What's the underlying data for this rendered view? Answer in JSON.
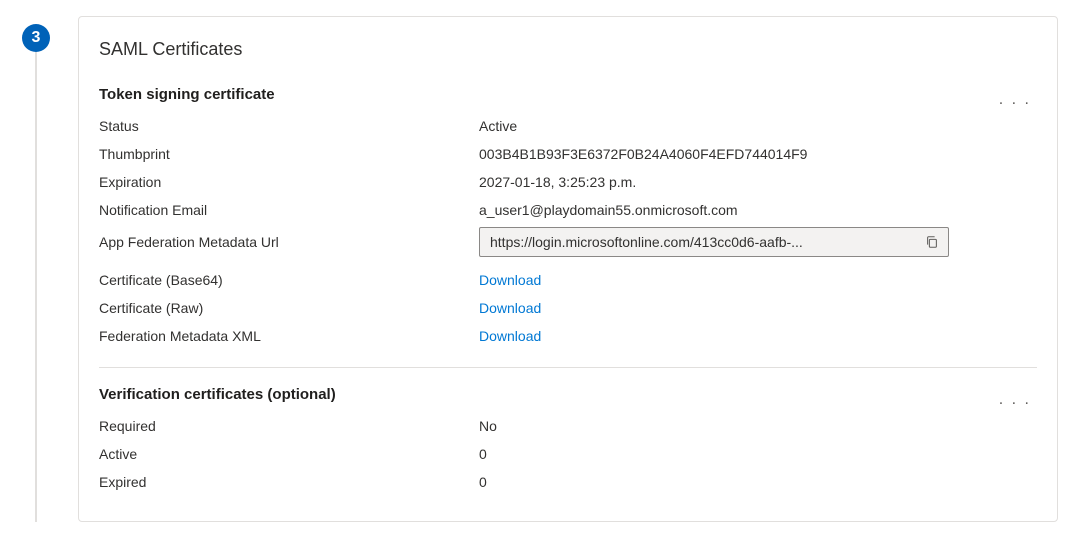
{
  "step": {
    "number": "3"
  },
  "card": {
    "title": "SAML Certificates"
  },
  "token_signing": {
    "title": "Token signing certificate",
    "labels": {
      "status": "Status",
      "thumbprint": "Thumbprint",
      "expiration": "Expiration",
      "notification_email": "Notification Email",
      "metadata_url": "App Federation Metadata Url",
      "cert_base64": "Certificate (Base64)",
      "cert_raw": "Certificate (Raw)",
      "fed_metadata_xml": "Federation Metadata XML"
    },
    "values": {
      "status": "Active",
      "thumbprint": "003B4B1B93F3E6372F0B24A4060F4EFD744014F9",
      "expiration": "2027-01-18, 3:25:23 p.m.",
      "notification_email": "a_user1@playdomain55.onmicrosoft.com",
      "metadata_url": "https://login.microsoftonline.com/413cc0d6-aafb-...",
      "download": "Download"
    }
  },
  "verification": {
    "title": "Verification certificates (optional)",
    "labels": {
      "required": "Required",
      "active": "Active",
      "expired": "Expired"
    },
    "values": {
      "required": "No",
      "active": "0",
      "expired": "0"
    }
  }
}
